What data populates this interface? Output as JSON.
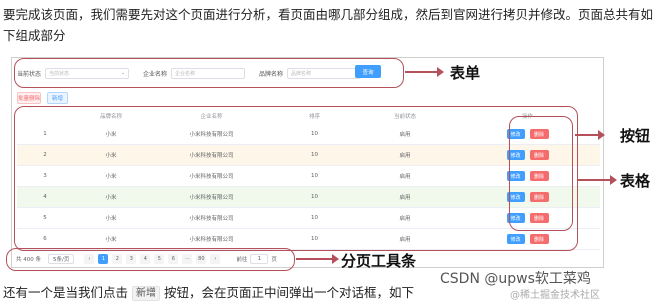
{
  "article": {
    "intro": "要完成该页面，我们需要先对这个页面进行分析，看页面由哪几部分组成，然后到官网进行拷贝并修改。页面总共有如下组成部分",
    "outro_before": "还有一个是当我们点击",
    "outro_chip": "新增",
    "outro_after": "按钮，会在页面正中间弹出一个对话框，如下"
  },
  "form": {
    "status_label": "当前状态",
    "status_placeholder": "当前状态",
    "company_label": "企业名称",
    "company_placeholder": "企业名称",
    "brand_label": "品牌名称",
    "brand_placeholder": "品牌名称",
    "query_button": "查询"
  },
  "actions": {
    "batch_delete": "批量删除",
    "add": "新增"
  },
  "table": {
    "columns": [
      "",
      "品牌名称",
      "企业名称",
      "排序",
      "当前状态",
      "操作"
    ],
    "edit_label": "修改",
    "delete_label": "删除",
    "rows": [
      {
        "index": "1",
        "brand": "小米",
        "company": "小米科技有限公司",
        "order": "10",
        "status": "启用"
      },
      {
        "index": "2",
        "brand": "小米",
        "company": "小米科技有限公司",
        "order": "10",
        "status": "启用"
      },
      {
        "index": "3",
        "brand": "小米",
        "company": "小米科技有限公司",
        "order": "10",
        "status": "启用"
      },
      {
        "index": "4",
        "brand": "小米",
        "company": "小米科技有限公司",
        "order": "10",
        "status": "启用"
      },
      {
        "index": "5",
        "brand": "小米",
        "company": "小米科技有限公司",
        "order": "10",
        "status": "启用"
      },
      {
        "index": "6",
        "brand": "小米",
        "company": "小米科技有限公司",
        "order": "10",
        "status": "启用"
      }
    ]
  },
  "pager": {
    "total": "共 400 条",
    "page_size": "5条/页",
    "prev": "‹",
    "pages": [
      "1",
      "2",
      "3",
      "4",
      "5",
      "6",
      "···",
      "80"
    ],
    "next": "›",
    "goto_label": "前往",
    "goto_value": "1",
    "goto_unit": "页"
  },
  "annotations": {
    "form": "表单",
    "buttons": "按钮",
    "table": "表格",
    "pager": "分页工具条"
  },
  "watermark": {
    "main": "CSDN @upws软工菜鸡",
    "sub": "@稀土掘金技术社区"
  },
  "colors": {
    "primary": "#409eff",
    "danger": "#f56c6c",
    "annotation": "#b5515b"
  }
}
